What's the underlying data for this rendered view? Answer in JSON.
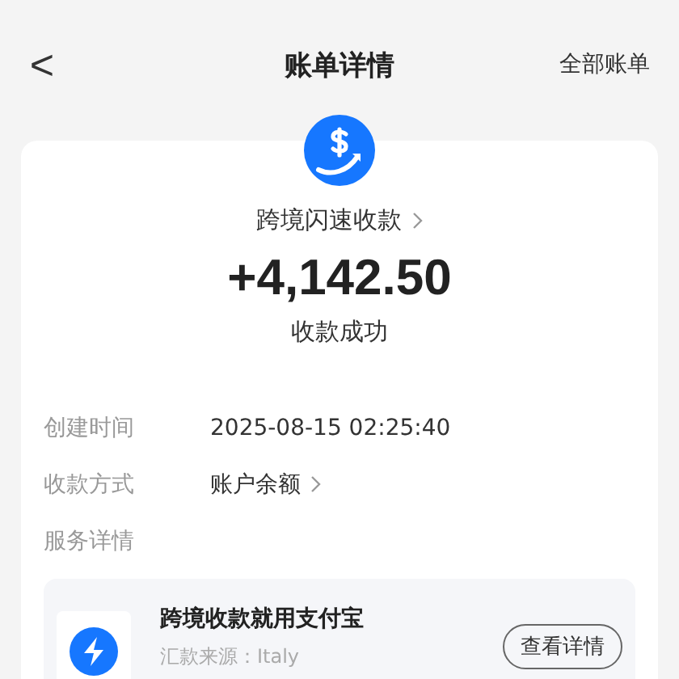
{
  "nav": {
    "back": "<",
    "title": "账单详情",
    "action": "全部账单"
  },
  "summary": {
    "service": "跨境闪速收款",
    "amount": "+4,142.50",
    "status": "收款成功"
  },
  "details": [
    {
      "label": "创建时间",
      "value": "2025-08-15 02:25:40",
      "link": false
    },
    {
      "label": "收款方式",
      "value": "账户余额",
      "link": true
    }
  ],
  "service_section": {
    "label": "服务详情",
    "title": "跨境收款就用支付宝",
    "lines": [
      "汇款来源：Italy"
    ],
    "button": "查看详情"
  }
}
